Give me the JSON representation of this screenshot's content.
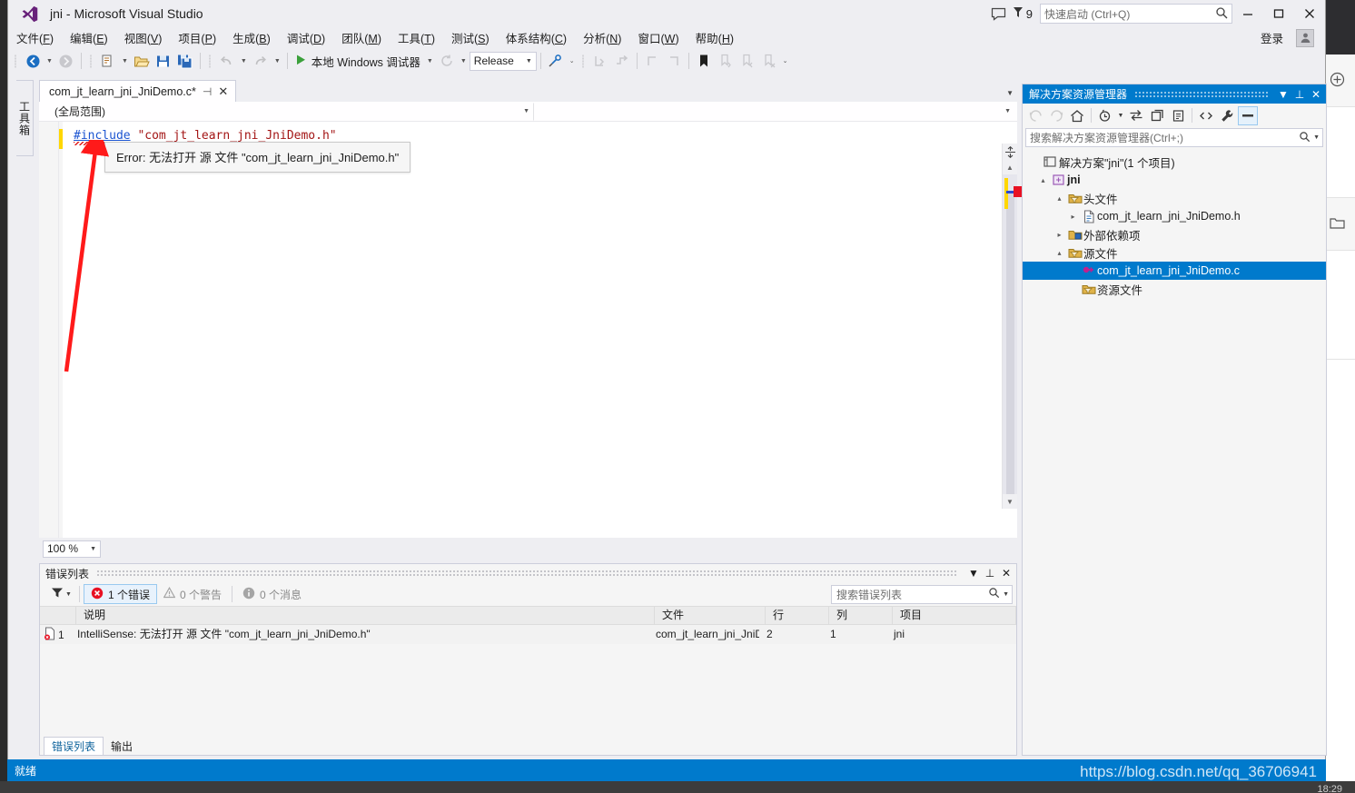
{
  "window": {
    "title": "jni - Microsoft Visual Studio",
    "logo_icon": "visual-studio-logo",
    "minimize_label": "—",
    "maximize_label": "▢",
    "close_label": "✕"
  },
  "titlebar": {
    "feedback_icon": "feedback-balloon-icon",
    "notification_icon": "notification-flag-icon",
    "notification_count": "9",
    "quick_launch_placeholder": "快速启动 (Ctrl+Q)",
    "quick_launch_value": "",
    "search_icon": "search-icon",
    "signin_label": "登录",
    "account_icon": "account-icon"
  },
  "menu": {
    "items": [
      {
        "label": "文件",
        "accel": "F"
      },
      {
        "label": "编辑",
        "accel": "E"
      },
      {
        "label": "视图",
        "accel": "V"
      },
      {
        "label": "项目",
        "accel": "P"
      },
      {
        "label": "生成",
        "accel": "B"
      },
      {
        "label": "调试",
        "accel": "D"
      },
      {
        "label": "团队",
        "accel": "M"
      },
      {
        "label": "工具",
        "accel": "T"
      },
      {
        "label": "测试",
        "accel": "S"
      },
      {
        "label": "体系结构",
        "accel": "C"
      },
      {
        "label": "分析",
        "accel": "N"
      },
      {
        "label": "窗口",
        "accel": "W"
      },
      {
        "label": "帮助",
        "accel": "H"
      }
    ]
  },
  "toolbar": {
    "back_icon": "navigate-backward-icon",
    "forward_icon": "navigate-forward-icon",
    "new_project_icon": "new-project-icon",
    "open_file_icon": "open-file-icon",
    "save_icon": "save-icon",
    "save_all_icon": "save-all-icon",
    "undo_icon": "undo-icon",
    "redo_icon": "redo-icon",
    "start_icon": "start-debug-play-icon",
    "start_label": "本地 Windows 调试器",
    "cycle_icon": "cycle-icon",
    "configuration": "Release",
    "attach_icon": "attach-process-icon",
    "step_icons": [
      "step-into-icon",
      "step-over-icon",
      "step-out-icon",
      "step-back-icon"
    ],
    "bookmark_icon": "bookmark-icon",
    "nav_icons": [
      "next-bookmark-icon",
      "prev-bookmark-icon",
      "clear-bookmark-icon"
    ],
    "overflow_icon": "toolbar-overflow-icon"
  },
  "toolbox": {
    "label": "工具箱"
  },
  "editor": {
    "tab_label": "com_jt_learn_jni_JniDemo.c*",
    "pin_icon": "pin-icon",
    "close_icon": "close-icon",
    "tab_overflow_icon": "chevron-down-icon",
    "scope_combo": "(全局范围)",
    "member_combo": "",
    "dropdown_icon": "chevron-down-icon",
    "code": {
      "directive": "#include",
      "string": "\"com_jt_learn_jni_JniDemo.h\""
    },
    "error_tooltip": "Error: 无法打开 源 文件 \"com_jt_learn_jni_JniDemo.h\"",
    "zoom_level": "100 %",
    "zoom_dropdown_icon": "chevron-down-icon",
    "scroll_up_icon": "scroll-up-arrow-icon",
    "scroll_down_icon": "scroll-down-arrow-icon",
    "split_icon": "split-view-icon"
  },
  "solution_explorer": {
    "title": "解决方案资源管理器",
    "dropdown_icon": "chevron-down-icon",
    "pin_icon": "pin-icon",
    "close_icon": "close-icon",
    "toolbar": {
      "back_icon": "back-arrow-icon",
      "forward_icon": "forward-arrow-icon",
      "home_icon": "home-icon",
      "pending_changes_icon": "pending-changes-icon",
      "pending_dropdown_icon": "chevron-down-icon",
      "sync_icon": "sync-with-active-document-icon",
      "refresh_icon": "refresh-icon",
      "collapse_all_icon": "collapse-all-icon",
      "show_all_files_icon": "show-all-files-icon",
      "properties_icon": "properties-wrench-icon",
      "preview_icon": "preview-selected-items-icon"
    },
    "search_placeholder": "搜索解决方案资源管理器(Ctrl+;)",
    "search_icon": "search-icon",
    "search_dropdown_icon": "chevron-down-icon",
    "tree": [
      {
        "label": "解决方案\"jni\"(1 个项目)",
        "indent": 0,
        "twisty": "",
        "icon": "solution-icon",
        "selected": false,
        "bold": false
      },
      {
        "label": "jni",
        "indent": 1,
        "twisty": "▴",
        "icon": "cpp-project-icon",
        "selected": false,
        "bold": true
      },
      {
        "label": "头文件",
        "indent": 2,
        "twisty": "▴",
        "icon": "folder-filter-icon",
        "selected": false,
        "bold": false
      },
      {
        "label": "com_jt_learn_jni_JniDemo.h",
        "indent": 3,
        "twisty": "▸",
        "icon": "header-file-icon",
        "selected": false,
        "bold": false
      },
      {
        "label": "外部依赖项",
        "indent": 2,
        "twisty": "▸",
        "icon": "external-dependencies-icon",
        "selected": false,
        "bold": false
      },
      {
        "label": "源文件",
        "indent": 2,
        "twisty": "▴",
        "icon": "folder-filter-icon",
        "selected": false,
        "bold": false
      },
      {
        "label": "com_jt_learn_jni_JniDemo.c",
        "indent": 3,
        "twisty": "",
        "icon": "c-source-file-icon",
        "selected": true,
        "bold": false
      },
      {
        "label": "资源文件",
        "indent": 2,
        "twisty": "",
        "icon": "folder-filter-icon",
        "selected": false,
        "bold": false
      }
    ]
  },
  "error_list": {
    "title": "错误列表",
    "dropdown_icon": "chevron-down-icon",
    "pin_icon": "pin-icon",
    "close_icon": "close-icon",
    "filter_icon": "filter-funnel-icon",
    "filter_dropdown_icon": "chevron-down-icon",
    "categories": [
      {
        "icon": "error-icon",
        "label": "1 个错误",
        "selected": true
      },
      {
        "icon": "warning-icon",
        "label": "0 个警告",
        "selected": false
      },
      {
        "icon": "info-icon",
        "label": "0 个消息",
        "selected": false
      }
    ],
    "search_placeholder": "搜索错误列表",
    "search_icon": "search-icon",
    "search_dropdown_icon": "chevron-down-icon",
    "columns": [
      "说明",
      "文件",
      "行",
      "列",
      "项目"
    ],
    "rows": [
      {
        "icon": "error-doc-icon",
        "number": "1",
        "description": "IntelliSense: 无法打开 源 文件 \"com_jt_learn_jni_JniDemo.h\"",
        "file": "com_jt_learn_jni_JniD",
        "line": "2",
        "column": "1",
        "project": "jni"
      }
    ],
    "tabs": [
      {
        "label": "错误列表",
        "active": true
      },
      {
        "label": "输出",
        "active": false
      }
    ]
  },
  "status_bar": {
    "text": "就绪",
    "watermark": "https://blog.csdn.net/qq_36706941"
  },
  "taskbar": {
    "clock": "18:29"
  },
  "background_panel": {
    "add_icon": "add-circle-icon",
    "folder_icon": "folder-icon"
  },
  "colors": {
    "accent": "#007acc",
    "chrome": "#eeeef2",
    "error_red": "#e81123",
    "warning_amber": "#ffd700",
    "code_directive": "#1b54d1",
    "code_string": "#a31515"
  }
}
